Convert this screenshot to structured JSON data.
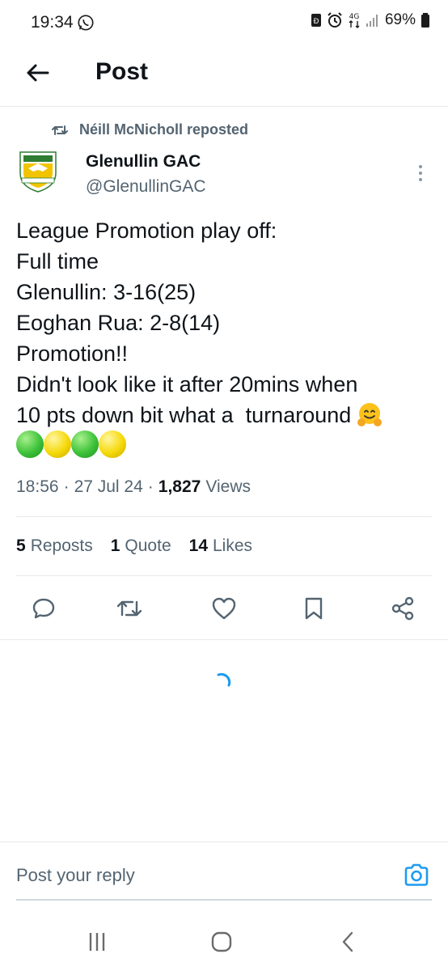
{
  "status_bar": {
    "time": "19:34",
    "battery": "69%",
    "network": "4G"
  },
  "header": {
    "title": "Post"
  },
  "post": {
    "repost_label": "Néill McNicholl reposted",
    "author_name": "Glenullin GAC",
    "author_handle": "@GlenullinGAC",
    "text_lines": [
      "League Promotion play off:",
      "Full time",
      "Glenullin: 3-16(25)",
      "Eoghan Rua: 2-8(14)",
      "Promotion!!",
      "Didn't look like it after 20mins when",
      "10 pts down bit what a  turnaround"
    ],
    "time": "18:56",
    "date": "27 Jul 24",
    "views_count": "1,827",
    "views_label": "Views",
    "separator": "·"
  },
  "stats": {
    "reposts_count": "5",
    "reposts_label": "Reposts",
    "quotes_count": "1",
    "quotes_label": "Quote",
    "likes_count": "14",
    "likes_label": "Likes"
  },
  "reply": {
    "placeholder": "Post your reply"
  },
  "colors": {
    "accent": "#1d9bf0",
    "secondary_text": "#536471",
    "primary_text": "#0f1419",
    "green_ball": "#3dc23a",
    "yellow_ball": "#f5d90a"
  }
}
